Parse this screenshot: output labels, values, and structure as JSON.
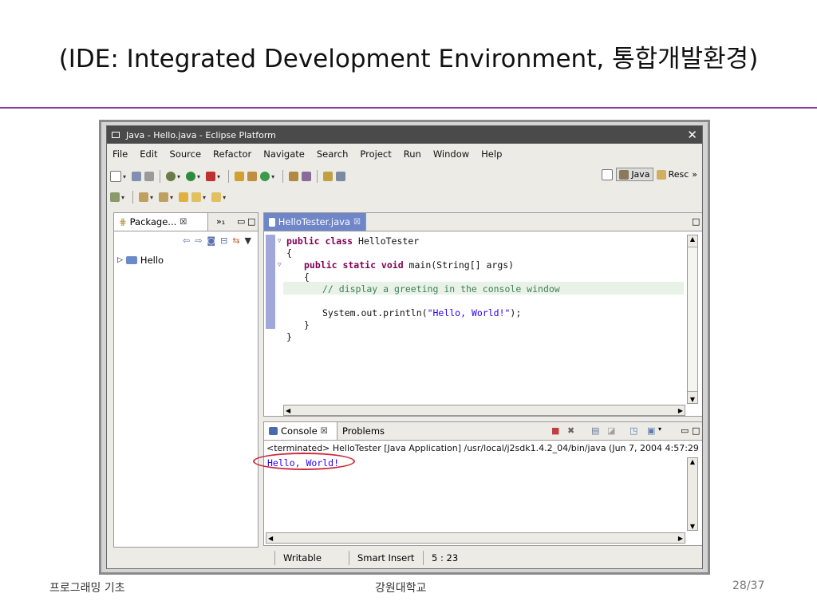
{
  "slide": {
    "title": "(IDE: Integrated Development Environment, 통합개발환경)",
    "footer_left": "프로그래밍 기초",
    "footer_center": "강원대학교",
    "page": "28/37",
    "accent_color": "#8b3a9a",
    "highlight_color": "#c8283c"
  },
  "window": {
    "title": "Java - Hello.java - Eclipse Platform",
    "close_glyph": "✕"
  },
  "menu": [
    "File",
    "Edit",
    "Source",
    "Refactor",
    "Navigate",
    "Search",
    "Project",
    "Run",
    "Window",
    "Help"
  ],
  "perspectives": {
    "java": "Java",
    "resource": "Resc",
    "more": "»"
  },
  "package_explorer": {
    "tab_label": "Package...",
    "tab_close": "☒",
    "more_tabs": "»₁",
    "tree": [
      {
        "label": "Hello",
        "expand": "▷"
      }
    ]
  },
  "editor": {
    "tab_label": "HelloTester.java",
    "tab_close": "☒",
    "lines": {
      "l1_kw": "public class",
      "l1_rest": " HelloTester",
      "l2": "{",
      "l3_kw": "public static void",
      "l3_rest": " main(String[] args)",
      "l4": "{",
      "l5": "// display a greeting in the console window",
      "l6_pre": "System.out.println(",
      "l6_str": "\"Hello, World!\"",
      "l6_post": ");",
      "l7": "}",
      "l8": "}"
    }
  },
  "console": {
    "tab_label": "Console",
    "tab_close": "☒",
    "problems_tab": "Problems",
    "status_line": "<terminated> HelloTester [Java Application] /usr/local/j2sdk1.4.2_04/bin/java (Jun 7, 2004 4:57:29 I",
    "output": "Hello, World!"
  },
  "statusbar": {
    "writable": "Writable",
    "insert_mode": "Smart Insert",
    "position": "5 : 23"
  }
}
